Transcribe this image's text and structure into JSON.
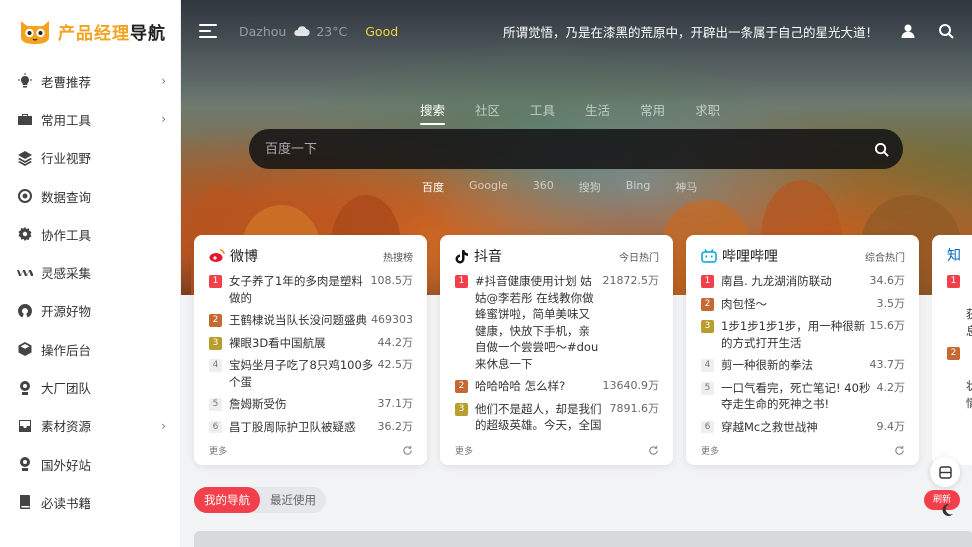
{
  "logo": {
    "text_main": "产品经理",
    "text_accent": "导航"
  },
  "sidebar": {
    "items": [
      {
        "label": "老曹推荐",
        "icon": "lightbulb-icon",
        "has_arrow": true
      },
      {
        "label": "常用工具",
        "icon": "toolbox-icon",
        "has_arrow": true
      },
      {
        "label": "行业视野",
        "icon": "layers-icon",
        "has_arrow": false
      },
      {
        "label": "数据查询",
        "icon": "target-icon",
        "has_arrow": false
      },
      {
        "label": "协作工具",
        "icon": "gear-people-icon",
        "has_arrow": false
      },
      {
        "label": "灵感采集",
        "icon": "wave-icon",
        "has_arrow": false
      },
      {
        "label": "开源好物",
        "icon": "open-source-icon",
        "has_arrow": false
      },
      {
        "label": "操作后台",
        "icon": "cube-icon",
        "has_arrow": false
      },
      {
        "label": "大厂团队",
        "icon": "team-icon",
        "has_arrow": false
      },
      {
        "label": "素材资源",
        "icon": "inbox-icon",
        "has_arrow": true
      },
      {
        "label": "国外好站",
        "icon": "pin-icon",
        "has_arrow": false
      },
      {
        "label": "必读书籍",
        "icon": "book-icon",
        "has_arrow": false
      }
    ]
  },
  "topbar": {
    "city": "Dazhou",
    "temperature": "23°C",
    "air_quality": "Good",
    "slogan": "所谓觉悟，乃是在漆黑的荒原中，开辟出一条属于自己的星光大道！"
  },
  "search": {
    "tabs": [
      "搜索",
      "社区",
      "工具",
      "生活",
      "常用",
      "求职"
    ],
    "active_tab": 0,
    "placeholder": "百度一下",
    "engines": [
      "百度",
      "Google",
      "360",
      "搜狗",
      "Bing",
      "神马"
    ],
    "active_engine": 0
  },
  "cards": [
    {
      "title": "微博",
      "subtitle": "热搜榜",
      "icon": "weibo-icon",
      "more": "更多",
      "items": [
        {
          "rank": "1",
          "text": "女子养了1年的多肉是塑料做的",
          "num": "108.5万"
        },
        {
          "rank": "2",
          "text": "王鹤棣说当队长没问题盛典",
          "num": "469303"
        },
        {
          "rank": "3",
          "text": "裸眼3D看中国航展",
          "num": "44.2万"
        },
        {
          "rank": "4",
          "text": "宝妈坐月子吃了8只鸡100多个蛋",
          "num": "42.5万"
        },
        {
          "rank": "5",
          "text": "詹姆斯受伤",
          "num": "37.1万"
        },
        {
          "rank": "6",
          "text": "昌丁股周际护卫队被疑惑",
          "num": "36.2万"
        }
      ]
    },
    {
      "title": "抖音",
      "subtitle": "今日热门",
      "icon": "douyin-icon",
      "more": "更多",
      "items": [
        {
          "rank": "1",
          "text": "#抖音健康使用计划 姑姑@李若彤 在线教你做蜂蜜饼啦，简单美味又健康，快放下手机，亲自做一个尝尝吧～#dou来休息一下",
          "num": "21872.5万"
        },
        {
          "rank": "2",
          "text": "哈哈哈哈 怎么样?",
          "num": "13640.9万"
        },
        {
          "rank": "3",
          "text": "他们不是超人，却是我们的超级英雄。今天，全国消防日，把所有的敬意献给他们。",
          "num": "7891.6万"
        }
      ]
    },
    {
      "title": "哔哩哔哩",
      "subtitle": "综合热门",
      "icon": "bilibili-icon",
      "more": "更多",
      "items": [
        {
          "rank": "1",
          "text": "南昌. 九龙湖消防联动",
          "num": "34.6万"
        },
        {
          "rank": "2",
          "text": "肉包怪～",
          "num": "3.5万"
        },
        {
          "rank": "3",
          "text": "1步1步1步1步，用一种很新的方式打开生活",
          "num": "15.6万"
        },
        {
          "rank": "4",
          "text": "剪一种很新的拳法",
          "num": "43.7万"
        },
        {
          "rank": "5",
          "text": "一口气看完，死亡笔记! 40秒夺走生命的死神之书!",
          "num": "4.2万"
        },
        {
          "rank": "6",
          "text": "穿越Mc之救世战神",
          "num": "9.4万"
        }
      ]
    }
  ],
  "peek_card": {
    "title": "知",
    "lines": [
      "误大",
      "获&",
      "息值",
      "确诊",
      "状频",
      "情信"
    ]
  },
  "nav_tabs": [
    "我的导航",
    "最近使用"
  ],
  "floating": {
    "red_label": "刷新"
  },
  "colors": {
    "accent": "#f1404b",
    "logo_orange": "#f4a21f",
    "aqi": "#f5d13b"
  }
}
